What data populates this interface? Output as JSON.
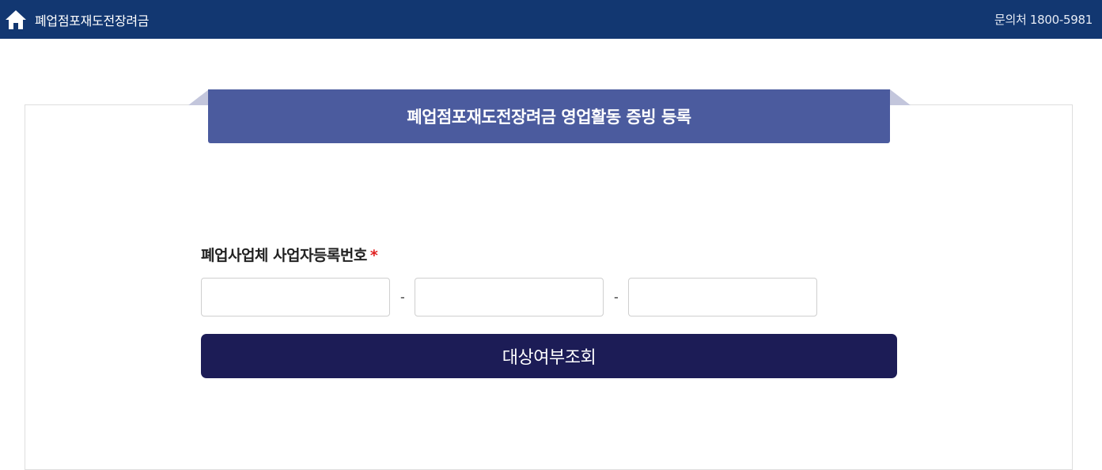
{
  "header": {
    "home_icon": "home-icon",
    "title": "폐업점포재도전장려금",
    "contact": "문의처 1800-5981"
  },
  "form": {
    "ribbon_title": "폐업점포재도전장려금 영업활동 증빙 등록",
    "label": "폐업사업체 사업자등록번호",
    "required_mark": "*",
    "separator": "-",
    "inputs": [
      {
        "value": "",
        "placeholder": ""
      },
      {
        "value": "",
        "placeholder": ""
      },
      {
        "value": "",
        "placeholder": ""
      }
    ],
    "submit_label": "대상여부조회"
  },
  "colors": {
    "header_bg": "#123771",
    "ribbon_bg": "#4b5b9e",
    "button_bg": "#1c1c56",
    "required": "#e02020"
  }
}
